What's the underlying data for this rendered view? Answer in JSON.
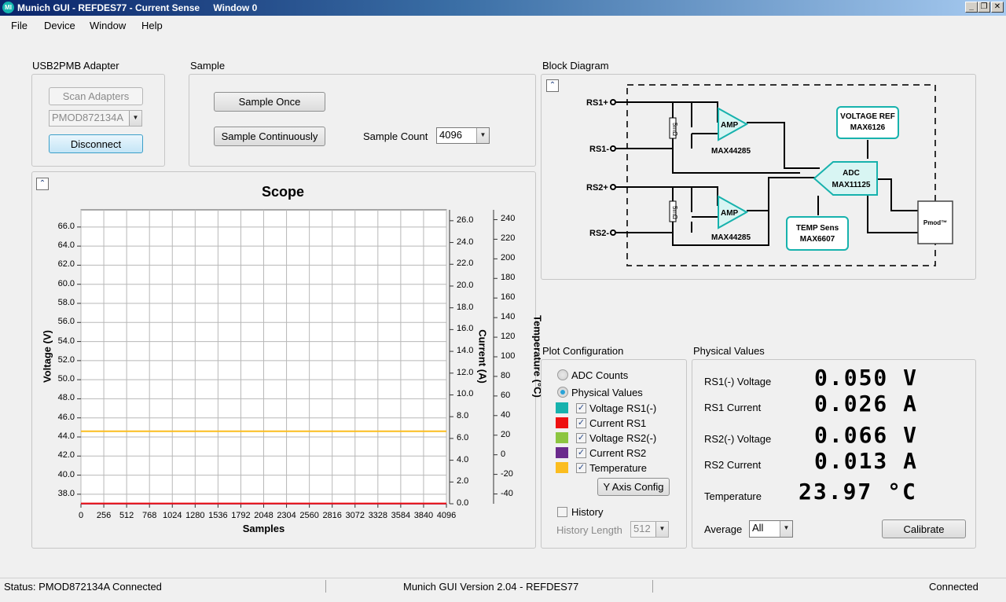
{
  "window": {
    "title": "Munich GUI - REFDES77 - Current Sense",
    "subtitle": "Window 0",
    "icon_text": "MI",
    "controls": [
      "minimize-icon",
      "restore-icon",
      "close-icon"
    ]
  },
  "menu": [
    "File",
    "Device",
    "Window",
    "Help"
  ],
  "usb2pmb": {
    "label": "USB2PMB Adapter",
    "scan_button": "Scan Adapters",
    "adapter_value": "PMOD872134A",
    "disconnect_button": "Disconnect"
  },
  "sample": {
    "label": "Sample",
    "sample_once": "Sample Once",
    "sample_continuously": "Sample Continuously",
    "count_label": "Sample Count",
    "count_value": "4096"
  },
  "scope": {
    "collapse_icon": "collapse-up-icon",
    "title": "Scope"
  },
  "block_diagram": {
    "label": "Block Diagram",
    "collapse_icon": "collapse-up-icon",
    "rs1p": "RS1+",
    "rs1m": "RS1-",
    "rs2p": "RS2+",
    "rs2m": "RS2-",
    "shunt": "5mΩ",
    "amp": "AMP",
    "amp_part": "MAX44285",
    "vref_line1": "VOLTAGE REF",
    "vref_line2": "MAX6126",
    "adc_line1": "ADC",
    "adc_line2": "MAX11125",
    "temp_line1": "TEMP Sens",
    "temp_line2": "MAX6607",
    "pmod": "Pmod™"
  },
  "plot_config": {
    "label": "Plot Configuration",
    "radio_adc": "ADC Counts",
    "radio_physical": "Physical Values",
    "series": [
      {
        "name": "Voltage RS1(-)",
        "color": "#17b2ad",
        "checked": true
      },
      {
        "name": "Current RS1",
        "color": "#ee1111",
        "checked": true
      },
      {
        "name": "Voltage RS2(-)",
        "color": "#8cc540",
        "checked": true
      },
      {
        "name": "Current RS2",
        "color": "#6a2a8c",
        "checked": true
      },
      {
        "name": "Temperature",
        "color": "#fbbd1f",
        "checked": true
      }
    ],
    "y_axis_button": "Y Axis Config",
    "history_label": "History",
    "history_length_label": "History Length",
    "history_length_value": "512"
  },
  "physical_values": {
    "label": "Physical Values",
    "rows": [
      {
        "label": "RS1(-) Voltage",
        "value": "0.050 V"
      },
      {
        "label": "RS1 Current",
        "value": "0.026 A"
      },
      {
        "label": "RS2(-) Voltage",
        "value": "0.066 V"
      },
      {
        "label": "RS2 Current",
        "value": "0.013 A"
      },
      {
        "label": "Temperature",
        "value": "23.97 °C"
      }
    ],
    "average_label": "Average",
    "average_value": "All",
    "calibrate_button": "Calibrate"
  },
  "status": {
    "left": "Status: PMOD872134A Connected",
    "center": "Munich GUI Version 2.04 - REFDES77",
    "right": "Connected"
  },
  "chart_data": {
    "type": "line",
    "title": "Scope",
    "xlabel": "Samples",
    "x_ticks": [
      0,
      256,
      512,
      768,
      1024,
      1280,
      1536,
      1792,
      2048,
      2304,
      2560,
      2816,
      3072,
      3328,
      3584,
      3840,
      4096
    ],
    "xlim": [
      0,
      4096
    ],
    "y_axes": [
      {
        "label": "Voltage (V)",
        "ticks": [
          "38.0",
          "40.0",
          "42.0",
          "44.0",
          "46.0",
          "48.0",
          "50.0",
          "52.0",
          "54.0",
          "56.0",
          "58.0",
          "60.0",
          "62.0",
          "64.0",
          "66.0"
        ],
        "min": 37.0,
        "max": 67.8
      },
      {
        "label": "Current (A)",
        "ticks": [
          "0.0",
          "2.0",
          "4.0",
          "6.0",
          "8.0",
          "10.0",
          "12.0",
          "14.0",
          "16.0",
          "18.0",
          "20.0",
          "22.0",
          "24.0",
          "26.0"
        ],
        "min": 0.0,
        "max": 27.0
      },
      {
        "label": "Temperature (°C)",
        "ticks": [
          "-40",
          "-20",
          "0",
          "20",
          "40",
          "60",
          "80",
          "100",
          "120",
          "140",
          "160",
          "180",
          "200",
          "220",
          "240"
        ],
        "min": -50.0,
        "max": 250.0
      }
    ],
    "grid": true,
    "series": [
      {
        "name": "Temperature",
        "axis": 2,
        "color": "#fbbd1f",
        "x": [
          0,
          4096
        ],
        "values": [
          23.97,
          23.97
        ]
      },
      {
        "name": "Current RS2",
        "axis": 1,
        "color": "#6a2a8c",
        "x": [
          0,
          4096
        ],
        "values": [
          0.013,
          0.013
        ]
      },
      {
        "name": "Current RS1",
        "axis": 1,
        "color": "#ee1111",
        "x": [
          0,
          4096
        ],
        "values": [
          0.026,
          0.026
        ]
      }
    ]
  }
}
